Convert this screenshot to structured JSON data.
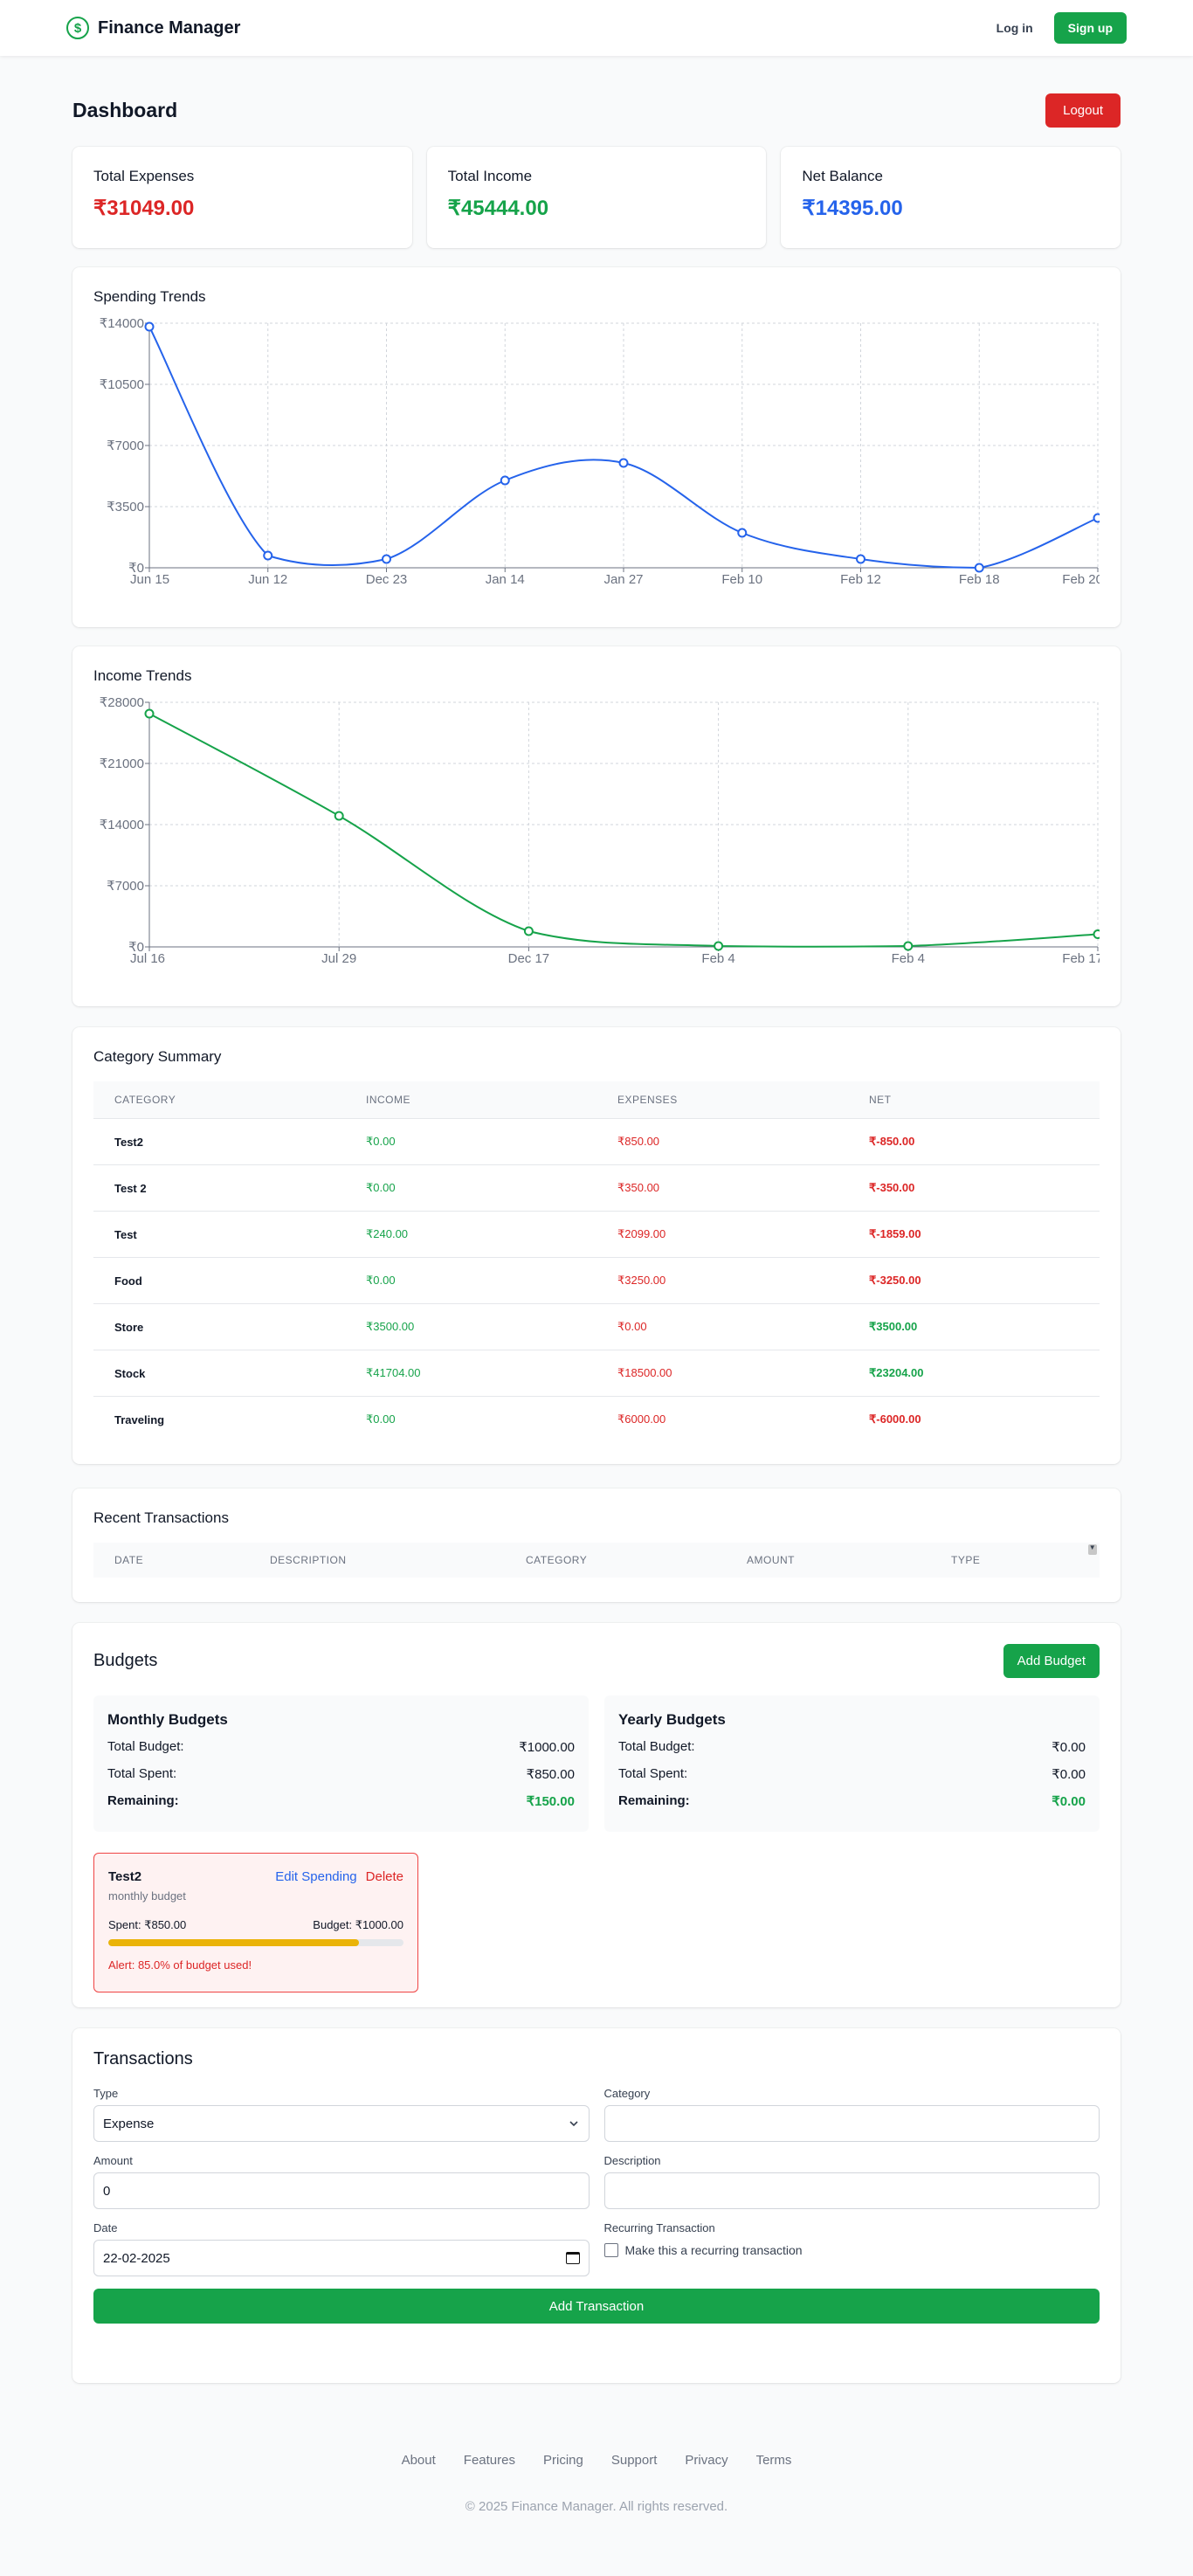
{
  "nav": {
    "brand": "Finance Manager",
    "logo_symbol": "$",
    "login": "Log in",
    "signup": "Sign up"
  },
  "dashboard": {
    "title": "Dashboard",
    "logout": "Logout"
  },
  "summary": {
    "expenses": {
      "label": "Total Expenses",
      "value": "₹31049.00"
    },
    "income": {
      "label": "Total Income",
      "value": "₹45444.00"
    },
    "balance": {
      "label": "Net Balance",
      "value": "₹14395.00"
    }
  },
  "spending_chart": {
    "title": "Spending Trends"
  },
  "income_chart": {
    "title": "Income Trends"
  },
  "chart_data": [
    {
      "type": "line",
      "title": "Spending Trends",
      "categories": [
        "Jun 15",
        "Jun 12",
        "Dec 23",
        "Jan 14",
        "Jan 27",
        "Feb 10",
        "Feb 12",
        "Feb 18",
        "Feb 20"
      ],
      "values": [
        13800,
        700,
        500,
        5000,
        6000,
        2000,
        500,
        0,
        2850
      ],
      "yticks": [
        "₹0",
        "₹3500",
        "₹7000",
        "₹10500",
        "₹14000"
      ],
      "ylim": [
        0,
        14000
      ],
      "color": "#2563eb",
      "grid": true
    },
    {
      "type": "line",
      "title": "Income Trends",
      "categories": [
        "Jul 16",
        "Jul 29",
        "Dec 17",
        "Feb 4",
        "Feb 4",
        "Feb 17"
      ],
      "values": [
        26700,
        15000,
        1800,
        100,
        100,
        1450
      ],
      "yticks": [
        "₹0",
        "₹7000",
        "₹14000",
        "₹21000",
        "₹28000"
      ],
      "ylim": [
        0,
        28000
      ],
      "color": "#16a34a",
      "grid": true
    }
  ],
  "category_summary": {
    "title": "Category Summary",
    "headers": [
      "CATEGORY",
      "INCOME",
      "EXPENSES",
      "NET"
    ],
    "rows": [
      {
        "category": "Test2",
        "income": "₹0.00",
        "expenses": "₹850.00",
        "net": "₹-850.00",
        "positive": false
      },
      {
        "category": "Test 2",
        "income": "₹0.00",
        "expenses": "₹350.00",
        "net": "₹-350.00",
        "positive": false
      },
      {
        "category": "Test",
        "income": "₹240.00",
        "expenses": "₹2099.00",
        "net": "₹-1859.00",
        "positive": false
      },
      {
        "category": "Food",
        "income": "₹0.00",
        "expenses": "₹3250.00",
        "net": "₹-3250.00",
        "positive": false
      },
      {
        "category": "Store",
        "income": "₹3500.00",
        "expenses": "₹0.00",
        "net": "₹3500.00",
        "positive": true
      },
      {
        "category": "Stock",
        "income": "₹41704.00",
        "expenses": "₹18500.00",
        "net": "₹23204.00",
        "positive": true
      },
      {
        "category": "Traveling",
        "income": "₹0.00",
        "expenses": "₹6000.00",
        "net": "₹-6000.00",
        "positive": false
      }
    ]
  },
  "recent_transactions": {
    "title": "Recent Transactions",
    "headers": [
      "DATE",
      "DESCRIPTION",
      "CATEGORY",
      "AMOUNT",
      "TYPE"
    ]
  },
  "budgets": {
    "title": "Budgets",
    "add_button": "Add Budget",
    "monthly": {
      "title": "Monthly Budgets",
      "total_budget_label": "Total Budget:",
      "total_budget": "₹1000.00",
      "total_spent_label": "Total Spent:",
      "total_spent": "₹850.00",
      "remaining_label": "Remaining:",
      "remaining": "₹150.00"
    },
    "yearly": {
      "title": "Yearly Budgets",
      "total_budget_label": "Total Budget:",
      "total_budget": "₹0.00",
      "total_spent_label": "Total Spent:",
      "total_spent": "₹0.00",
      "remaining_label": "Remaining:",
      "remaining": "₹0.00"
    },
    "item": {
      "name": "Test2",
      "period": "monthly budget",
      "edit": "Edit Spending",
      "delete": "Delete",
      "spent": "Spent: ₹850.00",
      "budget": "Budget: ₹1000.00",
      "progress": 0.85,
      "alert": "Alert: 85.0% of budget used!"
    }
  },
  "transactions_form": {
    "title": "Transactions",
    "type_label": "Type",
    "type_value": "Expense",
    "category_label": "Category",
    "category_value": "",
    "amount_label": "Amount",
    "amount_value": "0",
    "description_label": "Description",
    "description_value": "",
    "date_label": "Date",
    "date_value": "22-02-2025",
    "recurring_label": "Recurring Transaction",
    "recurring_text": "Make this a recurring transaction",
    "submit": "Add Transaction"
  },
  "footer": {
    "links": [
      "About",
      "Features",
      "Pricing",
      "Support",
      "Privacy",
      "Terms"
    ],
    "copyright": "© 2025 Finance Manager. All rights reserved."
  }
}
